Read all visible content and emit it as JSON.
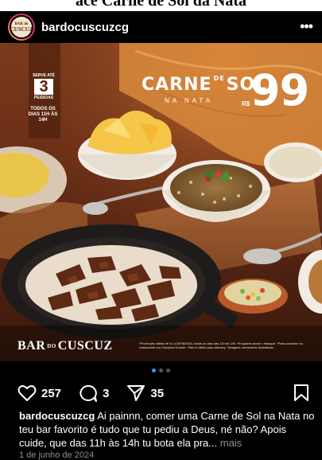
{
  "top_banner": {
    "text": "ace Carne de Sol da Nata"
  },
  "header": {
    "avatar_text_top": "BAR do",
    "avatar_text_bottom": "CUSCUZ",
    "username": "bardocuscuzcg",
    "more_icon": "more-horizontal-icon"
  },
  "post_image": {
    "badge_top": "SERVE ATÉ",
    "badge_number": "3",
    "badge_bottom": "PESSOAS",
    "hours": "TODOS OS DIAS 11H ÀS 14H",
    "title_part1": "CARNE",
    "title_de": "DE",
    "title_part2": "SOL",
    "title_sub": "NA NATA",
    "price_currency": "R$",
    "price_value": "99",
    "brand_part1": "BAR",
    "brand_do": "DO",
    "brand_part2": "CUSCUZ",
    "legal_text": "*Promoção válida de 01 a 30/06/2024, todos os dias das 11h às 14h. *Enquanto durar o estoque. *Para consumo no restaurante em Campina Grande. *Não é válido para delivery. *Imagens meramente ilustrativas."
  },
  "carousel": {
    "total": 3,
    "active_index": 0,
    "accent": "#3897f0"
  },
  "actions": {
    "likes": "257",
    "comments": "3",
    "shares": "35",
    "like_icon": "heart-icon",
    "comment_icon": "comment-icon",
    "share_icon": "send-icon",
    "save_icon": "bookmark-icon"
  },
  "caption": {
    "username": "bardocuscuzcg",
    "text": "Ai painnn, comer uma Carne de Sol na Nata no teu bar favorito é tudo que tu pediu a Deus, né não? Apois cuide, que das 11h às 14h tu bota ela pra...",
    "more_label": "mais"
  },
  "date": "1 de junho de 2024"
}
